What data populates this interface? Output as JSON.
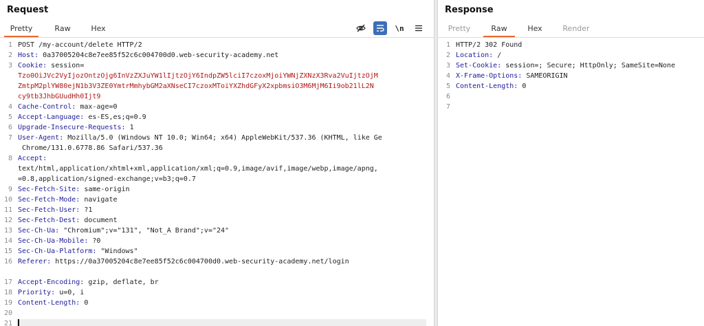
{
  "request": {
    "title": "Request",
    "tabs": [
      "Pretty",
      "Raw",
      "Hex"
    ],
    "active_tab": "Pretty",
    "tool_icons": [
      "eye-slash-icon",
      "wrap-icon",
      "newline-icon",
      "menu-icon"
    ],
    "newline_label": "\\n",
    "line_numbers": [
      "1",
      "2",
      "3",
      "4",
      "5",
      "6",
      "7",
      "8",
      "9",
      "10",
      "11",
      "12",
      "13",
      "14",
      "15",
      "16",
      "17",
      "18",
      "19",
      "20",
      "21"
    ],
    "lines": [
      {
        "text": "POST /my-account/delete HTTP/2"
      },
      {
        "name": "Host:",
        "value": " 0a37005204c8e7ee85f52c6c004700d0.web-security-academy.net"
      },
      {
        "name": "Cookie:",
        "value": " session="
      },
      {
        "red": "Tzo0OiJVc2VyIjozOntzOjg6InVzZXJuYW1lIjtzOjY6IndpZW5lciI7czoxMjoiYWNjZXNzX3Rva2VuIjtzOjM"
      },
      {
        "red": "ZmtpM2plYW80ejN1b3V3ZE0YmtrMmhybGM2aXNseCI7czoxMToiYXZhdGFyX2xpbmsiO3M6MjM6Ii9ob21lL2N"
      },
      {
        "red": "cy9tb3JhbGUudHh0Ijt9"
      },
      {
        "name": "Cache-Control:",
        "value": " max-age=0"
      },
      {
        "name": "Accept-Language:",
        "value": " es-ES,es;q=0.9"
      },
      {
        "name": "Upgrade-Insecure-Requests:",
        "value": " 1"
      },
      {
        "name": "User-Agent:",
        "value": " Mozilla/5.0 (Windows NT 10.0; Win64; x64) AppleWebKit/537.36 (KHTML, like Ge"
      },
      {
        "text": " Chrome/131.0.6778.86 Safari/537.36"
      },
      {
        "name": "Accept:",
        "value": ""
      },
      {
        "text": "text/html,application/xhtml+xml,application/xml;q=0.9,image/avif,image/webp,image/apng,"
      },
      {
        "text": "=0.8,application/signed-exchange;v=b3;q=0.7"
      },
      {
        "name": "Sec-Fetch-Site:",
        "value": " same-origin"
      },
      {
        "name": "Sec-Fetch-Mode:",
        "value": " navigate"
      },
      {
        "name": "Sec-Fetch-User:",
        "value": " ?1"
      },
      {
        "name": "Sec-Fetch-Dest:",
        "value": " document"
      },
      {
        "name": "Sec-Ch-Ua:",
        "value": " \"Chromium\";v=\"131\", \"Not_A Brand\";v=\"24\""
      },
      {
        "name": "Sec-Ch-Ua-Mobile:",
        "value": " ?0"
      },
      {
        "name": "Sec-Ch-Ua-Platform:",
        "value": " \"Windows\""
      },
      {
        "name": "Referer:",
        "value": " https://0a37005204c8e7ee85f52c6c004700d0.web-security-academy.net/login"
      },
      {
        "text": ""
      },
      {
        "name": "Accept-Encoding:",
        "value": " gzip, deflate, br"
      },
      {
        "name": "Priority:",
        "value": " u=0, i"
      },
      {
        "name": "Content-Length:",
        "value": " 0"
      },
      {
        "text": ""
      },
      {
        "text": ""
      }
    ]
  },
  "response": {
    "title": "Response",
    "tabs": [
      "Pretty",
      "Raw",
      "Hex",
      "Render"
    ],
    "active_tab": "Raw",
    "line_numbers": [
      "1",
      "2",
      "3",
      "4",
      "5",
      "6",
      "7"
    ],
    "lines": [
      {
        "text": "HTTP/2 302 Found"
      },
      {
        "name": "Location:",
        "value": " /"
      },
      {
        "name": "Set-Cookie:",
        "value": " session=; Secure; HttpOnly; SameSite=None"
      },
      {
        "name": "X-Frame-Options:",
        "value": " SAMEORIGIN"
      },
      {
        "name": "Content-Length:",
        "value": " 0"
      },
      {
        "text": ""
      },
      {
        "text": ""
      }
    ]
  },
  "colors": {
    "accent": "#e8692a",
    "header_name": "#1c1c9c",
    "cookie_value": "#b01616",
    "wrap_button": "#3d6fb8"
  }
}
